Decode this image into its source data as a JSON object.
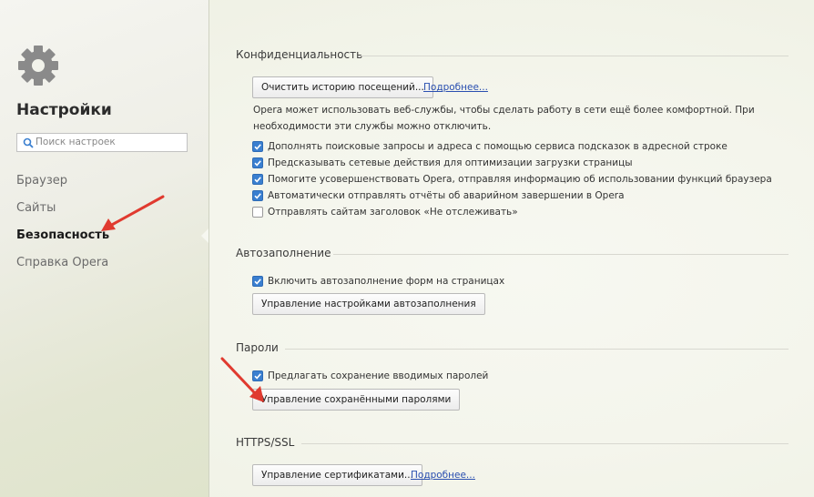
{
  "sidebar": {
    "title": "Настройки",
    "search_placeholder": "Поиск настроек",
    "items": [
      {
        "label": "Браузер",
        "active": false
      },
      {
        "label": "Сайты",
        "active": false
      },
      {
        "label": "Безопасность",
        "active": true
      },
      {
        "label": "Справка Opera",
        "active": false
      }
    ]
  },
  "privacy": {
    "title": "Конфиденциальность",
    "clear_button": "Очистить историю посещений...",
    "more_link": "Подробнее...",
    "description": "Opera может использовать веб-службы, чтобы сделать работу в сети ещё более комфортной. При необходимости эти службы можно отключить.",
    "options": [
      {
        "label": "Дополнять поисковые запросы и адреса с помощью сервиса подсказок в адресной строке",
        "checked": true
      },
      {
        "label": "Предсказывать сетевые действия для оптимизации загрузки страницы",
        "checked": true
      },
      {
        "label": "Помогите усовершенствовать Opera, отправляя информацию об использовании функций браузера",
        "checked": true
      },
      {
        "label": "Автоматически отправлять отчёты об аварийном завершении в Opera",
        "checked": true
      },
      {
        "label": "Отправлять сайтам заголовок «Не отслеживать»",
        "checked": false
      }
    ]
  },
  "autofill": {
    "title": "Автозаполнение",
    "option": {
      "label": "Включить автозаполнение форм на страницах",
      "checked": true
    },
    "manage_button": "Управление настройками автозаполнения"
  },
  "passwords": {
    "title": "Пароли",
    "option": {
      "label": "Предлагать сохранение вводимых паролей",
      "checked": true
    },
    "manage_button": "Управление сохранёнными паролями"
  },
  "https": {
    "title": "HTTPS/SSL",
    "manage_button": "Управление сертификатами...",
    "more_link": "Подробнее..."
  },
  "colors": {
    "accent": "#3a7fd0",
    "link": "#2a4fb0",
    "arrow": "#e03a2f"
  },
  "icons": [
    "gear-icon",
    "search-icon",
    "checkmark-icon"
  ]
}
